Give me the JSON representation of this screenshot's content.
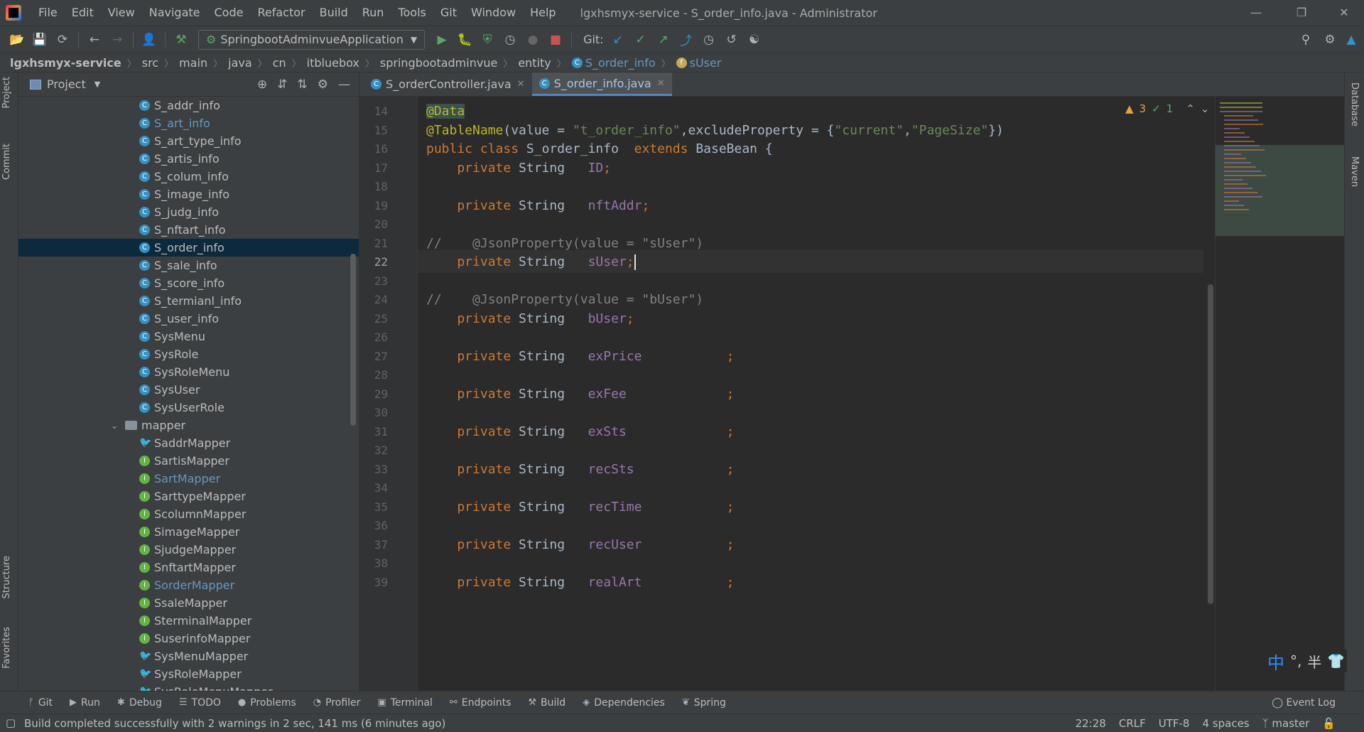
{
  "menu": [
    "File",
    "Edit",
    "View",
    "Navigate",
    "Code",
    "Refactor",
    "Build",
    "Run",
    "Tools",
    "Git",
    "Window",
    "Help"
  ],
  "window_title": "lgxhsmyx-service - S_order_info.java - Administrator",
  "toolbar": {
    "run_config": "SpringbootAdminvueApplication",
    "git_label": "Git:"
  },
  "breadcrumb": [
    "lgxhsmyx-service",
    "src",
    "main",
    "java",
    "cn",
    "itbluebox",
    "springbootadminvue",
    "entity",
    "S_order_info",
    "sUser"
  ],
  "left_stripe": [
    "Project",
    "Commit",
    "Structure",
    "Favorites"
  ],
  "right_stripe": [
    "Database",
    "Maven"
  ],
  "project": {
    "title": "Project",
    "tree": [
      {
        "label": "S_addr_info",
        "kind": "cls"
      },
      {
        "label": "S_art_info",
        "kind": "cls",
        "modified": true
      },
      {
        "label": "S_art_type_info",
        "kind": "cls"
      },
      {
        "label": "S_artis_info",
        "kind": "cls"
      },
      {
        "label": "S_colum_info",
        "kind": "cls"
      },
      {
        "label": "S_image_info",
        "kind": "cls"
      },
      {
        "label": "S_judg_info",
        "kind": "cls"
      },
      {
        "label": "S_nftart_info",
        "kind": "cls"
      },
      {
        "label": "S_order_info",
        "kind": "cls",
        "selected": true
      },
      {
        "label": "S_sale_info",
        "kind": "cls"
      },
      {
        "label": "S_score_info",
        "kind": "cls"
      },
      {
        "label": "S_termianl_info",
        "kind": "cls"
      },
      {
        "label": "S_user_info",
        "kind": "cls"
      },
      {
        "label": "SysMenu",
        "kind": "cls"
      },
      {
        "label": "SysRole",
        "kind": "cls"
      },
      {
        "label": "SysRoleMenu",
        "kind": "cls"
      },
      {
        "label": "SysUser",
        "kind": "cls"
      },
      {
        "label": "SysUserRole",
        "kind": "cls"
      },
      {
        "label": "mapper",
        "kind": "folder"
      },
      {
        "label": "SaddrMapper",
        "kind": "mybatis"
      },
      {
        "label": "SartisMapper",
        "kind": "iface"
      },
      {
        "label": "SartMapper",
        "kind": "iface",
        "modified": true
      },
      {
        "label": "SarttypeMapper",
        "kind": "iface"
      },
      {
        "label": "ScolumnMapper",
        "kind": "iface"
      },
      {
        "label": "SimageMapper",
        "kind": "iface"
      },
      {
        "label": "SjudgeMapper",
        "kind": "iface"
      },
      {
        "label": "SnftartMapper",
        "kind": "iface"
      },
      {
        "label": "SorderMapper",
        "kind": "iface",
        "modified": true
      },
      {
        "label": "SsaleMapper",
        "kind": "iface"
      },
      {
        "label": "SterminalMapper",
        "kind": "iface"
      },
      {
        "label": "SuserinfoMapper",
        "kind": "iface"
      },
      {
        "label": "SysMenuMapper",
        "kind": "mybatis"
      },
      {
        "label": "SysRoleMapper",
        "kind": "mybatis"
      },
      {
        "label": "SysRoleMenuMapper",
        "kind": "mybatis"
      }
    ]
  },
  "editor": {
    "tabs": [
      {
        "label": "S_orderController.java",
        "active": false
      },
      {
        "label": "S_order_info.java",
        "active": true
      }
    ],
    "inspections": {
      "warnings": "3",
      "weak_warnings": "1"
    },
    "current_line": 22,
    "lines": [
      {
        "n": 14,
        "tokens": [
          {
            "t": "@Data",
            "c": "ann-hl"
          }
        ]
      },
      {
        "n": 15,
        "tokens": [
          {
            "t": "@TableName",
            "c": "ann"
          },
          {
            "t": "(value = ",
            "c": ""
          },
          {
            "t": "\"t_order_info\"",
            "c": "str"
          },
          {
            "t": ",excludeProperty = {",
            "c": ""
          },
          {
            "t": "\"current\"",
            "c": "str"
          },
          {
            "t": ",",
            "c": ""
          },
          {
            "t": "\"PageSize\"",
            "c": "str"
          },
          {
            "t": "})",
            "c": ""
          }
        ]
      },
      {
        "n": 16,
        "tokens": [
          {
            "t": "public class ",
            "c": "kw"
          },
          {
            "t": "S_order_info  ",
            "c": ""
          },
          {
            "t": "extends ",
            "c": "kw"
          },
          {
            "t": "BaseBean {",
            "c": ""
          }
        ]
      },
      {
        "n": 17,
        "tokens": [
          {
            "t": "    private ",
            "c": "kw"
          },
          {
            "t": "String   ",
            "c": ""
          },
          {
            "t": "ID",
            "c": "fld"
          },
          {
            "t": ";",
            "c": "kw"
          }
        ]
      },
      {
        "n": 18,
        "tokens": []
      },
      {
        "n": 19,
        "tokens": [
          {
            "t": "    private ",
            "c": "kw"
          },
          {
            "t": "String   ",
            "c": ""
          },
          {
            "t": "nftAddr",
            "c": "fld"
          },
          {
            "t": ";",
            "c": "kw"
          }
        ]
      },
      {
        "n": 20,
        "tokens": []
      },
      {
        "n": 21,
        "tokens": [
          {
            "t": "//    @JsonProperty(value = \"sUser\")",
            "c": "cmt"
          }
        ]
      },
      {
        "n": 22,
        "tokens": [
          {
            "t": "    private ",
            "c": "kw"
          },
          {
            "t": "String   ",
            "c": ""
          },
          {
            "t": "sUser",
            "c": "fld"
          },
          {
            "t": ";",
            "c": "kw"
          }
        ]
      },
      {
        "n": 23,
        "tokens": []
      },
      {
        "n": 24,
        "tokens": [
          {
            "t": "//    @JsonProperty(value = \"bUser\")",
            "c": "cmt"
          }
        ]
      },
      {
        "n": 25,
        "tokens": [
          {
            "t": "    private ",
            "c": "kw"
          },
          {
            "t": "String   ",
            "c": ""
          },
          {
            "t": "bUser",
            "c": "fld"
          },
          {
            "t": ";",
            "c": "kw"
          }
        ]
      },
      {
        "n": 26,
        "tokens": []
      },
      {
        "n": 27,
        "tokens": [
          {
            "t": "    private ",
            "c": "kw"
          },
          {
            "t": "String   ",
            "c": ""
          },
          {
            "t": "exPrice           ",
            "c": "fld"
          },
          {
            "t": ";",
            "c": "kw"
          }
        ]
      },
      {
        "n": 28,
        "tokens": []
      },
      {
        "n": 29,
        "tokens": [
          {
            "t": "    private ",
            "c": "kw"
          },
          {
            "t": "String   ",
            "c": ""
          },
          {
            "t": "exFee             ",
            "c": "fld"
          },
          {
            "t": ";",
            "c": "kw"
          }
        ]
      },
      {
        "n": 30,
        "tokens": []
      },
      {
        "n": 31,
        "tokens": [
          {
            "t": "    private ",
            "c": "kw"
          },
          {
            "t": "String   ",
            "c": ""
          },
          {
            "t": "exSts             ",
            "c": "fld"
          },
          {
            "t": ";",
            "c": "kw"
          }
        ]
      },
      {
        "n": 32,
        "tokens": []
      },
      {
        "n": 33,
        "tokens": [
          {
            "t": "    private ",
            "c": "kw"
          },
          {
            "t": "String   ",
            "c": ""
          },
          {
            "t": "recSts            ",
            "c": "fld"
          },
          {
            "t": ";",
            "c": "kw"
          }
        ]
      },
      {
        "n": 34,
        "tokens": []
      },
      {
        "n": 35,
        "tokens": [
          {
            "t": "    private ",
            "c": "kw"
          },
          {
            "t": "String   ",
            "c": ""
          },
          {
            "t": "recTime           ",
            "c": "fld"
          },
          {
            "t": ";",
            "c": "kw"
          }
        ]
      },
      {
        "n": 36,
        "tokens": []
      },
      {
        "n": 37,
        "tokens": [
          {
            "t": "    private ",
            "c": "kw"
          },
          {
            "t": "String   ",
            "c": ""
          },
          {
            "t": "recUser           ",
            "c": "fld"
          },
          {
            "t": ";",
            "c": "kw"
          }
        ]
      },
      {
        "n": 38,
        "tokens": []
      },
      {
        "n": 39,
        "tokens": [
          {
            "t": "    private ",
            "c": "kw"
          },
          {
            "t": "String   ",
            "c": ""
          },
          {
            "t": "realArt           ",
            "c": "fld"
          },
          {
            "t": ";",
            "c": "kw"
          }
        ]
      }
    ]
  },
  "ime": {
    "lang": "中",
    "punct": "°,",
    "width": "半"
  },
  "bottom_tools": [
    {
      "label": "Git",
      "icon": "git-icon"
    },
    {
      "label": "Run",
      "icon": "run-icon"
    },
    {
      "label": "Debug",
      "icon": "debug-icon"
    },
    {
      "label": "TODO",
      "icon": "todo-icon"
    },
    {
      "label": "Problems",
      "icon": "problems-icon"
    },
    {
      "label": "Profiler",
      "icon": "profiler-icon"
    },
    {
      "label": "Terminal",
      "icon": "terminal-icon"
    },
    {
      "label": "Endpoints",
      "icon": "endpoints-icon"
    },
    {
      "label": "Build",
      "icon": "build-icon"
    },
    {
      "label": "Dependencies",
      "icon": "dependencies-icon"
    },
    {
      "label": "Spring",
      "icon": "spring-icon"
    }
  ],
  "event_log": "Event Log",
  "status": {
    "message": "Build completed successfully with 2 warnings in 2 sec, 141 ms (6 minutes ago)",
    "position": "22:28",
    "line_sep": "CRLF",
    "encoding": "UTF-8",
    "indent": "4 spaces",
    "branch": "master"
  }
}
